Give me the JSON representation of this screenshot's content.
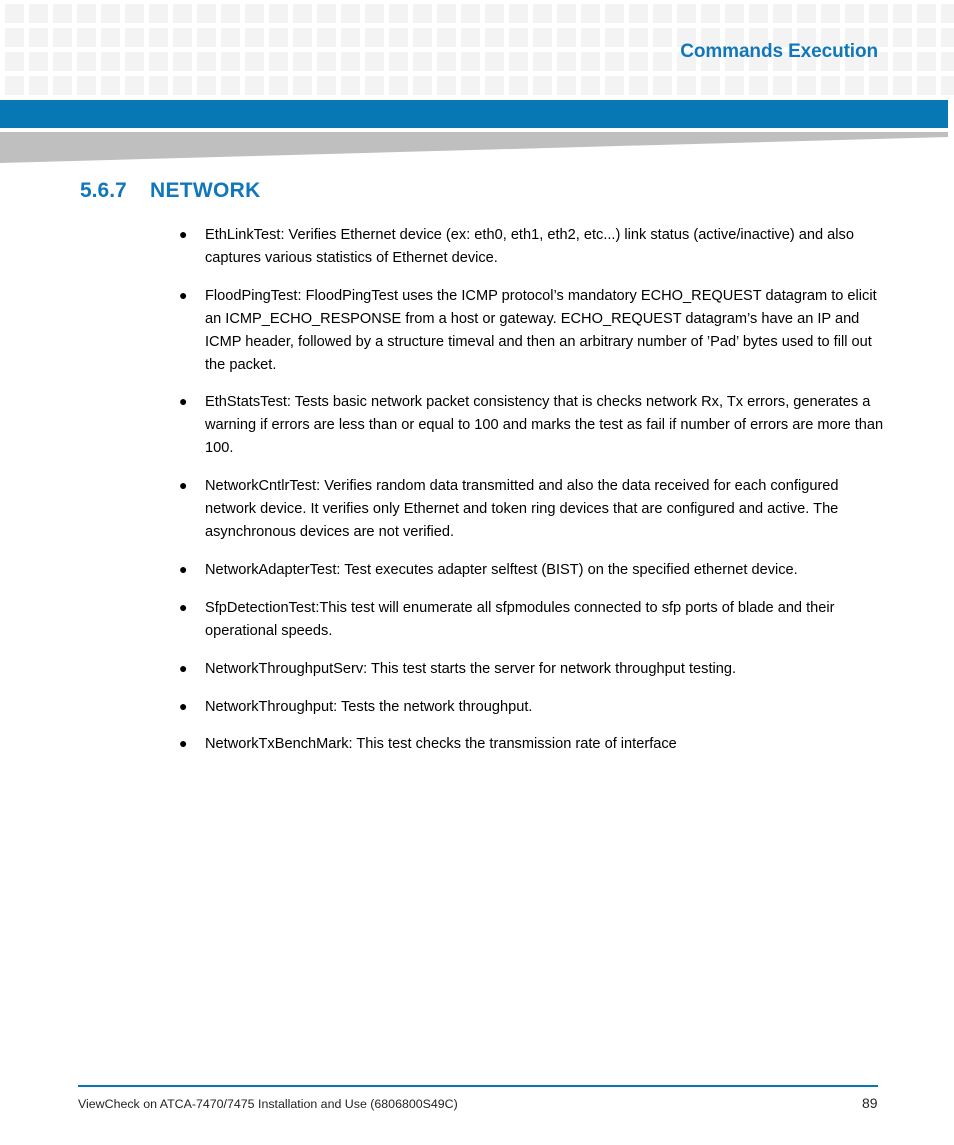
{
  "header": {
    "title": "Commands Execution",
    "accent_color": "#0878b4",
    "title_color": "#1177bb",
    "grid_square_color": "#f3f3f3",
    "wedge_color": "#bfbfbf"
  },
  "section": {
    "number": "5.6.7",
    "title": "NETWORK"
  },
  "bullets": [
    {
      "marker": "●",
      "text": "EthLinkTest: Verifies Ethernet device (ex: eth0, eth1, eth2, etc...) link status (active/inactive) and also captures various statistics of Ethernet device."
    },
    {
      "marker": "●",
      "text": "FloodPingTest: FloodPingTest uses the ICMP protocol’s mandatory ECHO_REQUEST datagram to elicit an ICMP_ECHO_RESPONSE from a host or gateway. ECHO_REQUEST datagram’s have an IP and ICMP header, followed by a structure timeval and then an arbitrary number of ’Pad’ bytes used to fill out the packet."
    },
    {
      "marker": "●",
      "text": "EthStatsTest: Tests basic network packet consistency that is checks network Rx, Tx errors, generates a warning if errors are less than or equal to 100 and marks the test as fail if number of errors are more than 100."
    },
    {
      "marker": "●",
      "text": "NetworkCntlrTest: Verifies random data transmitted and also the data received for each configured network device. It verifies only Ethernet and token ring devices that are configured and active. The asynchronous devices are not verified."
    },
    {
      "marker": "●",
      "text": "NetworkAdapterTest: Test executes adapter selftest (BIST) on the specified ethernet device."
    },
    {
      "marker": "●",
      "text": "SfpDetectionTest:This test will enumerate all sfpmodules connected to sfp ports of blade and their operational speeds."
    },
    {
      "marker": "●",
      "text": "NetworkThroughputServ: This test starts the server for network throughput testing."
    },
    {
      "marker": "●",
      "text": "NetworkThroughput: Tests the network throughput."
    },
    {
      "marker": "●",
      "text": "NetworkTxBenchMark: This test checks the transmission rate of interface"
    }
  ],
  "footer": {
    "document_title": "ViewCheck on ATCA-7470/7475 Installation and Use (6806800S49C)",
    "page_number": "89",
    "rule_color": "#0878b4"
  }
}
